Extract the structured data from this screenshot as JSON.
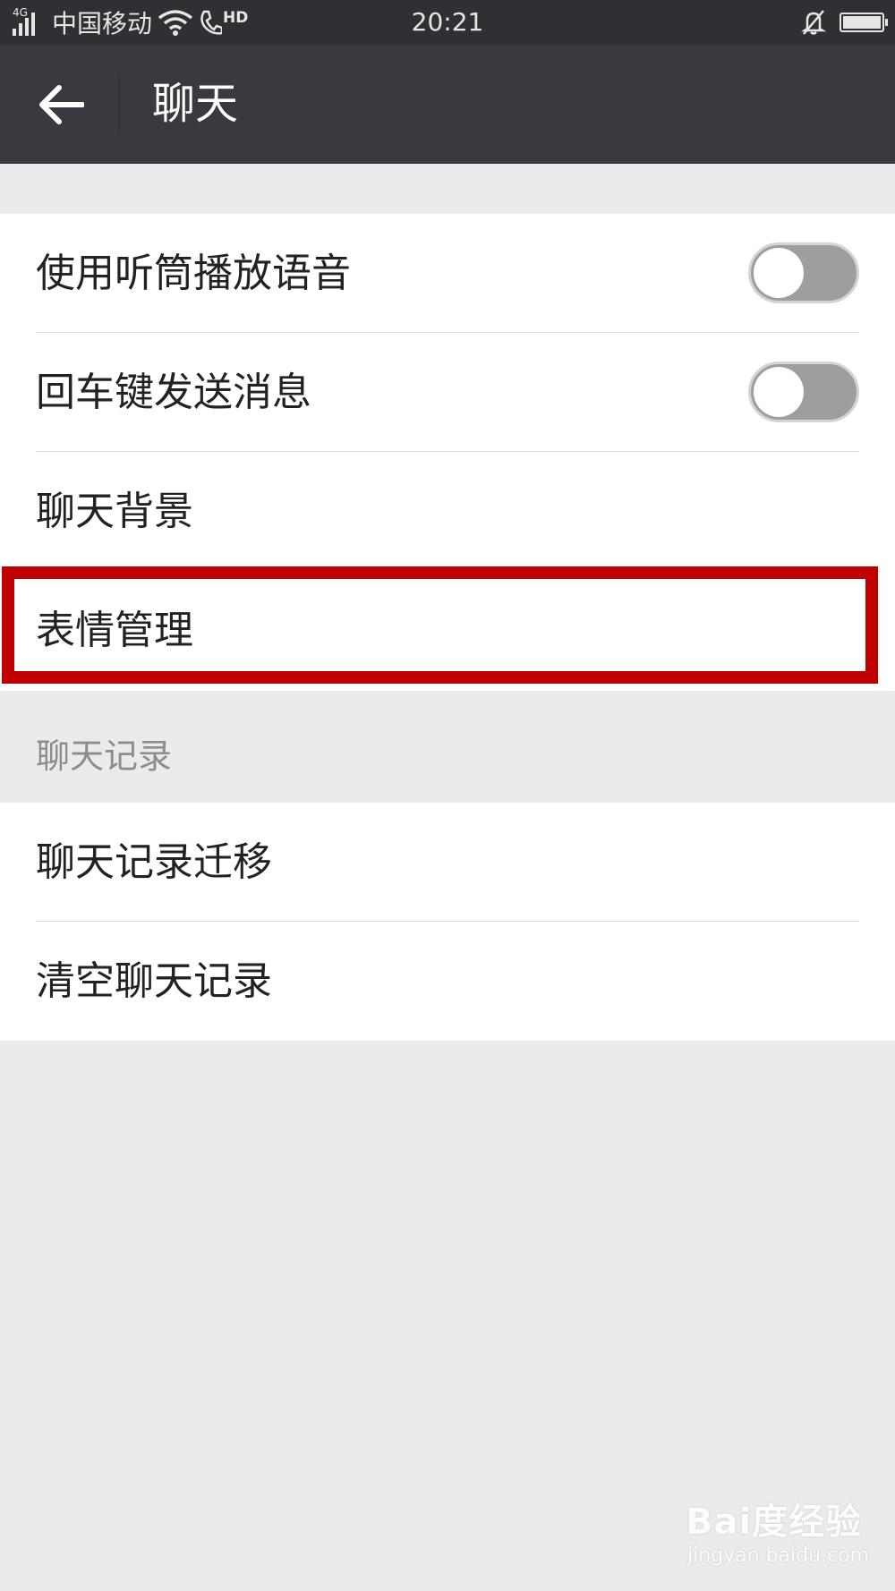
{
  "status_bar": {
    "network": "4G",
    "carrier": "中国移动",
    "hd": "HD",
    "time": "20:21"
  },
  "header": {
    "title": "聊天",
    "back_icon": "arrow-left-icon"
  },
  "settings_group_1": [
    {
      "label": "使用听筒播放语音",
      "toggle": false
    },
    {
      "label": "回车键发送消息",
      "toggle": false
    },
    {
      "label": "聊天背景"
    },
    {
      "label": "表情管理",
      "highlighted": true
    }
  ],
  "chat_history_section": {
    "header": "聊天记录",
    "items": [
      {
        "label": "聊天记录迁移"
      },
      {
        "label": "清空聊天记录"
      }
    ]
  },
  "colors": {
    "status_bar": "#2e3033",
    "app_bar": "#393a3f",
    "highlight": "#c00000",
    "background": "#ebebeb"
  },
  "watermark": {
    "logo": "Bai度经验",
    "url": "jingyan.baidu.com"
  }
}
